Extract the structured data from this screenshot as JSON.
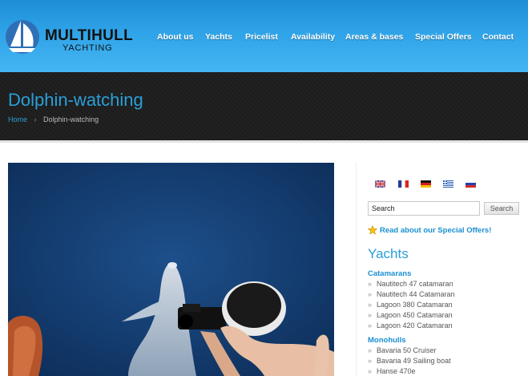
{
  "logo": {
    "name": "MULTIHULL",
    "tagline": "YACHTING"
  },
  "nav": [
    {
      "label": "About us"
    },
    {
      "label": "Yachts"
    },
    {
      "label": "Pricelist"
    },
    {
      "label": "Availability"
    },
    {
      "label": "Areas & bases"
    },
    {
      "label": "Special Offers"
    },
    {
      "label": "Contact"
    }
  ],
  "page": {
    "title": "Dolphin-watching",
    "breadcrumb": {
      "home": "Home",
      "separator": "›",
      "current": "Dolphin-watching"
    }
  },
  "sidebar": {
    "flags": [
      "uk-flag-icon",
      "france-flag-icon",
      "germany-flag-icon",
      "greece-flag-icon",
      "russia-flag-icon"
    ],
    "search": {
      "value": "Search",
      "button": "Search"
    },
    "special_link": "Read about our Special Offers!",
    "yachts_heading": "Yachts",
    "categories": [
      {
        "name": "Catamarans",
        "items": [
          "Nautitech 47 catamaran",
          "Nautitech 44 Catamaran",
          "Lagoon 380 Catamaran",
          "Lagoon 450 Catamaran",
          "Lagoon 420 Catamaran"
        ]
      },
      {
        "name": "Monohulls",
        "items": [
          "Bavaria 50 Cruiser",
          "Bavaria 49 Sailing boat",
          "Hanse 470e"
        ]
      }
    ]
  },
  "colors": {
    "accent": "#2a9fd8",
    "header_blue": "#2fa3e8",
    "title_band": "#1c1c1c"
  }
}
